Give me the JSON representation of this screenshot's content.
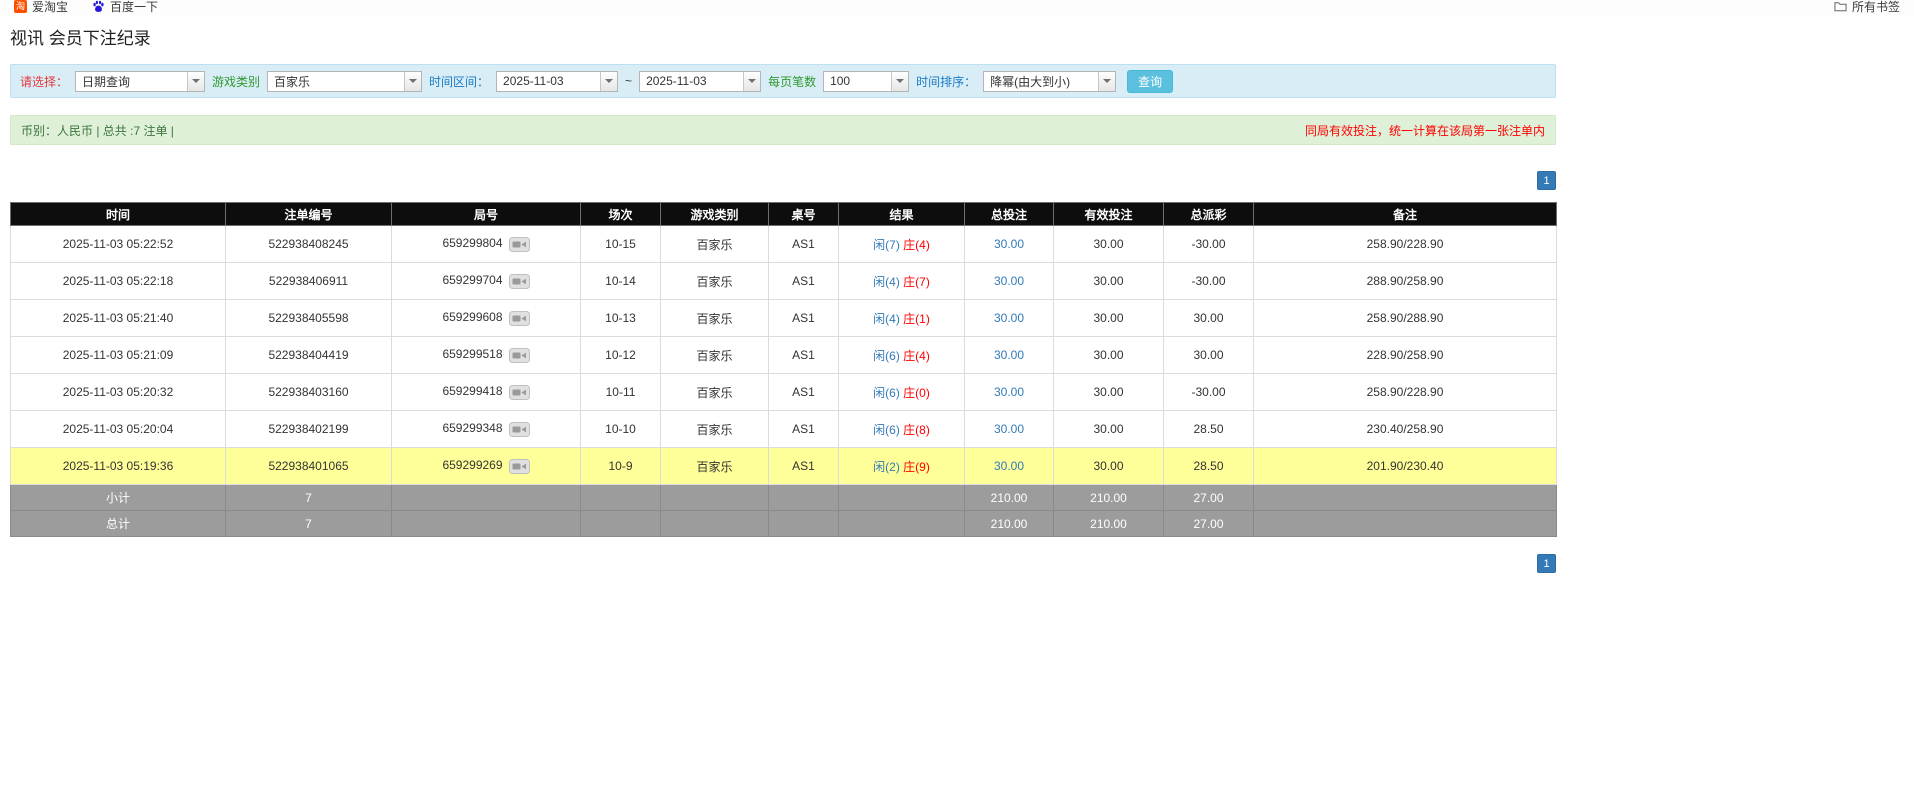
{
  "bookmarks_bar": {
    "items": [
      {
        "label": "爱淘宝",
        "icon": "taobao-icon"
      },
      {
        "label": "百度一下",
        "icon": "baidu-paw-icon"
      }
    ],
    "all_bookmarks_label": "所有书签"
  },
  "page": {
    "title": "视讯 会员下注纪录"
  },
  "filters": {
    "select_label": "请选择：",
    "select_value": "日期查询",
    "game_type_label": "游戏类别",
    "game_type_value": "百家乐",
    "time_range_label": "时间区间：",
    "date_from": "2025-11-03",
    "date_separator": "~",
    "date_to": "2025-11-03",
    "page_size_label": "每页笔数",
    "page_size_value": "100",
    "sort_label": "时间排序：",
    "sort_value": "降幂(由大到小)",
    "search_button_label": "查询"
  },
  "summary": {
    "left_text": "币别：人民币 | 总共 :7 注单 |",
    "right_text": "同局有效投注，统一计算在该局第一张注单内"
  },
  "pagination": {
    "current_page": "1"
  },
  "table": {
    "headers": [
      "时间",
      "注单编号",
      "局号",
      "场次",
      "游戏类别",
      "桌号",
      "结果",
      "总投注",
      "有效投注",
      "总派彩",
      "备注"
    ],
    "rows": [
      {
        "time": "2025-11-03 05:22:52",
        "bet_id": "522938408245",
        "round_id": "659299804",
        "session": "10-15",
        "game": "百家乐",
        "table_no": "AS1",
        "result_player": "闲(7)",
        "result_banker": "庄(4)",
        "total_bet": "30.00",
        "valid_bet": "30.00",
        "payout": "-30.00",
        "remark": "258.90/228.90",
        "highlight": false
      },
      {
        "time": "2025-11-03 05:22:18",
        "bet_id": "522938406911",
        "round_id": "659299704",
        "session": "10-14",
        "game": "百家乐",
        "table_no": "AS1",
        "result_player": "闲(4)",
        "result_banker": "庄(7)",
        "total_bet": "30.00",
        "valid_bet": "30.00",
        "payout": "-30.00",
        "remark": "288.90/258.90",
        "highlight": false
      },
      {
        "time": "2025-11-03 05:21:40",
        "bet_id": "522938405598",
        "round_id": "659299608",
        "session": "10-13",
        "game": "百家乐",
        "table_no": "AS1",
        "result_player": "闲(4)",
        "result_banker": "庄(1)",
        "total_bet": "30.00",
        "valid_bet": "30.00",
        "payout": "30.00",
        "remark": "258.90/288.90",
        "highlight": false
      },
      {
        "time": "2025-11-03 05:21:09",
        "bet_id": "522938404419",
        "round_id": "659299518",
        "session": "10-12",
        "game": "百家乐",
        "table_no": "AS1",
        "result_player": "闲(6)",
        "result_banker": "庄(4)",
        "total_bet": "30.00",
        "valid_bet": "30.00",
        "payout": "30.00",
        "remark": "228.90/258.90",
        "highlight": false
      },
      {
        "time": "2025-11-03 05:20:32",
        "bet_id": "522938403160",
        "round_id": "659299418",
        "session": "10-11",
        "game": "百家乐",
        "table_no": "AS1",
        "result_player": "闲(6)",
        "result_banker": "庄(0)",
        "total_bet": "30.00",
        "valid_bet": "30.00",
        "payout": "-30.00",
        "remark": "258.90/228.90",
        "highlight": false
      },
      {
        "time": "2025-11-03 05:20:04",
        "bet_id": "522938402199",
        "round_id": "659299348",
        "session": "10-10",
        "game": "百家乐",
        "table_no": "AS1",
        "result_player": "闲(6)",
        "result_banker": "庄(8)",
        "total_bet": "30.00",
        "valid_bet": "30.00",
        "payout": "28.50",
        "remark": "230.40/258.90",
        "highlight": false
      },
      {
        "time": "2025-11-03 05:19:36",
        "bet_id": "522938401065",
        "round_id": "659299269",
        "session": "10-9",
        "game": "百家乐",
        "table_no": "AS1",
        "result_player": "闲(2)",
        "result_banker": "庄(9)",
        "total_bet": "30.00",
        "valid_bet": "30.00",
        "payout": "28.50",
        "remark": "201.90/230.40",
        "highlight": true
      }
    ],
    "subtotal": {
      "label": "小计",
      "count": "7",
      "total_bet": "210.00",
      "valid_bet": "210.00",
      "payout": "27.00"
    },
    "grand_total": {
      "label": "总计",
      "count": "7",
      "total_bet": "210.00",
      "valid_bet": "210.00",
      "payout": "27.00"
    }
  },
  "colors": {
    "accent_blue": "#337ab7",
    "negative_red": "#ff0000",
    "player_blue": "#337ab7",
    "banker_red": "#ff0000",
    "highlight_yellow": "#ffff99",
    "header_black": "#0d0d0d",
    "footer_gray": "#9c9c9c",
    "filter_bar_bg": "#d9edf7",
    "summary_bar_bg": "#dff0d8",
    "search_button_bg": "#5bc0de"
  }
}
